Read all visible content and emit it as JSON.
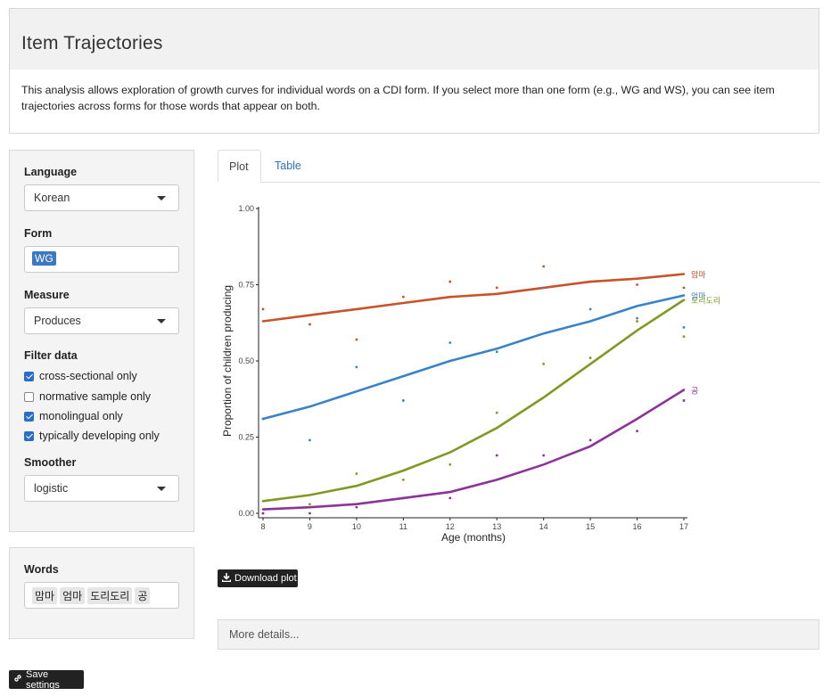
{
  "header": {
    "title": "Item Trajectories"
  },
  "description": "This analysis allows exploration of growth curves for individual words on a CDI form. If you select more than one form (e.g., WG and WS), you can see item trajectories across forms for those words that appear on both.",
  "controls": {
    "language_label": "Language",
    "language_value": "Korean",
    "form_label": "Form",
    "form_chips": [
      "WG"
    ],
    "measure_label": "Measure",
    "measure_value": "Produces",
    "filter_label": "Filter data",
    "filters": [
      {
        "label": "cross-sectional only",
        "checked": true
      },
      {
        "label": "normative sample only",
        "checked": false
      },
      {
        "label": "monolingual only",
        "checked": true
      },
      {
        "label": "typically developing only",
        "checked": true
      }
    ],
    "smoother_label": "Smoother",
    "smoother_value": "logistic"
  },
  "words_panel": {
    "label": "Words",
    "chips": [
      "맘마",
      "엄마",
      "도리도리",
      "공"
    ]
  },
  "tabs": [
    "Plot",
    "Table"
  ],
  "active_tab": "Plot",
  "download_label": "Download plot",
  "more_details_label": "More details...",
  "save_label": "Save settings",
  "icons": {
    "download": "download-icon",
    "link": "link-icon",
    "caret": "caret-down-icon",
    "check": "check-icon"
  },
  "chart_data": {
    "type": "scatter",
    "xlabel": "Age (months)",
    "ylabel": "Proportion of children producing",
    "xlim": [
      8,
      17
    ],
    "ylim": [
      0,
      1
    ],
    "x_ticks": [
      "8",
      "9",
      "10",
      "11",
      "12",
      "13",
      "14",
      "15",
      "16",
      "17"
    ],
    "y_ticks": [
      "0.00",
      "0.25",
      "0.50",
      "0.75",
      "1.00"
    ],
    "grid": false,
    "x": [
      8,
      9,
      10,
      11,
      12,
      13,
      14,
      15,
      16,
      17
    ],
    "series": [
      {
        "color": "#c8522a",
        "points": [
          0.67,
          0.62,
          0.57,
          0.71,
          0.76,
          0.74,
          0.81,
          0.76,
          0.75,
          0.74
        ],
        "fit": [
          0.63,
          0.65,
          0.67,
          0.69,
          0.71,
          0.72,
          0.74,
          0.76,
          0.77,
          0.785
        ],
        "end_label": "맘마"
      },
      {
        "color": "#3883c8",
        "points": [
          0.31,
          0.24,
          0.48,
          0.37,
          0.56,
          0.53,
          0.74,
          0.67,
          0.64,
          0.61
        ],
        "fit": [
          0.31,
          0.35,
          0.4,
          0.45,
          0.5,
          0.54,
          0.59,
          0.63,
          0.68,
          0.715
        ],
        "end_label": "엄마"
      },
      {
        "color": "#7f9a22",
        "points": [
          0.0,
          0.03,
          0.13,
          0.11,
          0.16,
          0.33,
          0.49,
          0.51,
          0.63,
          0.58
        ],
        "fit": [
          0.04,
          0.06,
          0.09,
          0.14,
          0.2,
          0.28,
          0.38,
          0.49,
          0.6,
          0.7
        ],
        "end_label": "도리도리"
      },
      {
        "color": "#8c3399",
        "points": [
          0.0,
          0.0,
          0.02,
          0.05,
          0.05,
          0.19,
          0.19,
          0.24,
          0.27,
          0.37
        ],
        "fit": [
          0.013,
          0.02,
          0.03,
          0.05,
          0.07,
          0.11,
          0.16,
          0.22,
          0.31,
          0.405
        ],
        "end_label": "공"
      }
    ]
  }
}
